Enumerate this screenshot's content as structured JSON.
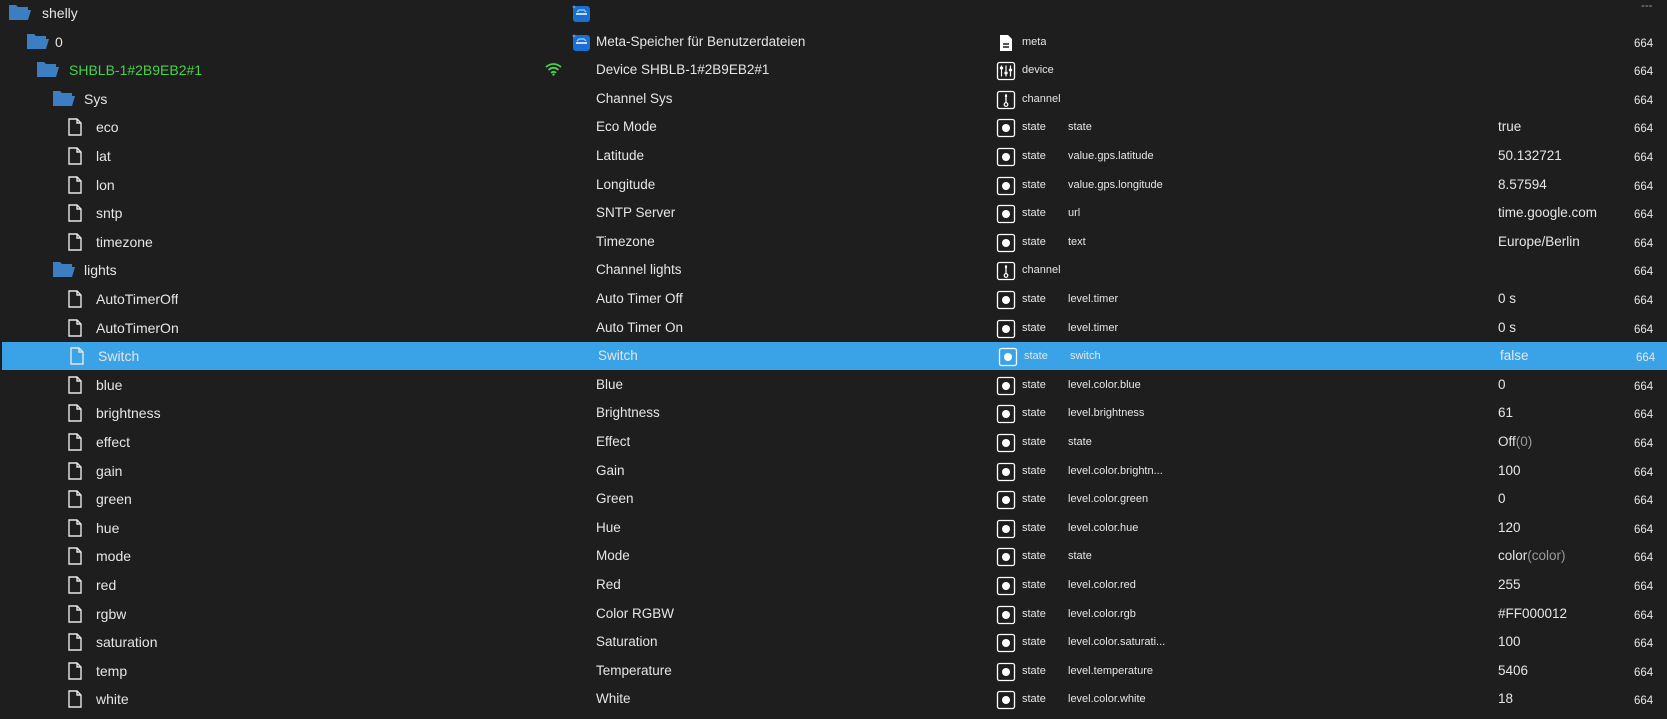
{
  "colors": {
    "background": "#1e1e1e",
    "selected_row": "#3aa3e8",
    "device_name": "#4ad14a",
    "wifi": "#4ad14a",
    "folder": "#3b7fc2",
    "text": "#e6e6e6",
    "value_hint": "#9a9a9a"
  },
  "rows": [
    {
      "kind": "folder",
      "level": 0,
      "name": "shelly",
      "desc": "",
      "adapter_icon": true,
      "type_icon": "",
      "type": "",
      "role": "",
      "value": "",
      "value_hint": "",
      "ts": "---"
    },
    {
      "kind": "folder",
      "level": 1,
      "name": "0",
      "desc": "Meta-Speicher für Benutzerdateien",
      "adapter_icon": true,
      "type_icon": "meta-icon",
      "type": "meta",
      "role": "",
      "value": "",
      "value_hint": "",
      "ts": "664"
    },
    {
      "kind": "folder",
      "level": 2,
      "name": "SHBLB-1#2B9EB2#1",
      "desc": "Device SHBLB-1#2B9EB2#1",
      "wifi": true,
      "name_color": "device",
      "type_icon": "device-icon",
      "type": "device",
      "role": "",
      "value": "",
      "value_hint": "",
      "ts": "664"
    },
    {
      "kind": "folder",
      "level": 3,
      "name": "Sys",
      "desc": "Channel Sys",
      "type_icon": "channel-icon",
      "type": "channel",
      "role": "",
      "value": "",
      "value_hint": "",
      "ts": "664"
    },
    {
      "kind": "file",
      "level": 4,
      "name": "eco",
      "desc": "Eco Mode",
      "type_icon": "state-icon",
      "type": "state",
      "role": "state",
      "value": "true",
      "value_hint": "",
      "ts": "664"
    },
    {
      "kind": "file",
      "level": 4,
      "name": "lat",
      "desc": "Latitude",
      "type_icon": "state-icon",
      "type": "state",
      "role": "value.gps.latitude",
      "value": "50.132721",
      "value_hint": "",
      "ts": "664"
    },
    {
      "kind": "file",
      "level": 4,
      "name": "lon",
      "desc": "Longitude",
      "type_icon": "state-icon",
      "type": "state",
      "role": "value.gps.longitude",
      "value": "8.57594",
      "value_hint": "",
      "ts": "664"
    },
    {
      "kind": "file",
      "level": 4,
      "name": "sntp",
      "desc": "SNTP Server",
      "type_icon": "state-icon",
      "type": "state",
      "role": "url",
      "value": "time.google.com",
      "value_hint": "",
      "ts": "664"
    },
    {
      "kind": "file",
      "level": 4,
      "name": "timezone",
      "desc": "Timezone",
      "type_icon": "state-icon",
      "type": "state",
      "role": "text",
      "value": "Europe/Berlin",
      "value_hint": "",
      "ts": "664"
    },
    {
      "kind": "folder",
      "level": 3,
      "name": "lights",
      "desc": "Channel lights",
      "type_icon": "channel-icon",
      "type": "channel",
      "role": "",
      "value": "",
      "value_hint": "",
      "ts": "664"
    },
    {
      "kind": "file",
      "level": 4,
      "name": "AutoTimerOff",
      "desc": "Auto Timer Off",
      "type_icon": "state-icon",
      "type": "state",
      "role": "level.timer",
      "value": "0 s",
      "value_hint": "",
      "ts": "664"
    },
    {
      "kind": "file",
      "level": 4,
      "name": "AutoTimerOn",
      "desc": "Auto Timer On",
      "type_icon": "state-icon",
      "type": "state",
      "role": "level.timer",
      "value": "0 s",
      "value_hint": "",
      "ts": "664"
    },
    {
      "kind": "file",
      "level": 4,
      "name": "Switch",
      "desc": "Switch",
      "selected": true,
      "type_icon": "state-icon",
      "type": "state",
      "role": "switch",
      "value": "false",
      "value_hint": "",
      "ts": "664"
    },
    {
      "kind": "file",
      "level": 4,
      "name": "blue",
      "desc": "Blue",
      "type_icon": "state-icon",
      "type": "state",
      "role": "level.color.blue",
      "value": "0",
      "value_hint": "",
      "ts": "664"
    },
    {
      "kind": "file",
      "level": 4,
      "name": "brightness",
      "desc": "Brightness",
      "type_icon": "state-icon",
      "type": "state",
      "role": "level.brightness",
      "value": "61",
      "value_hint": "",
      "ts": "664"
    },
    {
      "kind": "file",
      "level": 4,
      "name": "effect",
      "desc": "Effect",
      "type_icon": "state-icon",
      "type": "state",
      "role": "state",
      "value": "Off",
      "value_hint": "(0)",
      "ts": "664"
    },
    {
      "kind": "file",
      "level": 4,
      "name": "gain",
      "desc": "Gain",
      "type_icon": "state-icon",
      "type": "state",
      "role": "level.color.brightn...",
      "value": "100",
      "value_hint": "",
      "ts": "664"
    },
    {
      "kind": "file",
      "level": 4,
      "name": "green",
      "desc": "Green",
      "type_icon": "state-icon",
      "type": "state",
      "role": "level.color.green",
      "value": "0",
      "value_hint": "",
      "ts": "664"
    },
    {
      "kind": "file",
      "level": 4,
      "name": "hue",
      "desc": "Hue",
      "type_icon": "state-icon",
      "type": "state",
      "role": "level.color.hue",
      "value": "120",
      "value_hint": "",
      "ts": "664"
    },
    {
      "kind": "file",
      "level": 4,
      "name": "mode",
      "desc": "Mode",
      "type_icon": "state-icon",
      "type": "state",
      "role": "state",
      "value": "color",
      "value_hint": "(color)",
      "ts": "664"
    },
    {
      "kind": "file",
      "level": 4,
      "name": "red",
      "desc": "Red",
      "type_icon": "state-icon",
      "type": "state",
      "role": "level.color.red",
      "value": "255",
      "value_hint": "",
      "ts": "664"
    },
    {
      "kind": "file",
      "level": 4,
      "name": "rgbw",
      "desc": "Color RGBW",
      "type_icon": "state-icon",
      "type": "state",
      "role": "level.color.rgb",
      "value": "#FF000012",
      "value_hint": "",
      "ts": "664"
    },
    {
      "kind": "file",
      "level": 4,
      "name": "saturation",
      "desc": "Saturation",
      "type_icon": "state-icon",
      "type": "state",
      "role": "level.color.saturati...",
      "value": "100",
      "value_hint": "",
      "ts": "664"
    },
    {
      "kind": "file",
      "level": 4,
      "name": "temp",
      "desc": "Temperature",
      "type_icon": "state-icon",
      "type": "state",
      "role": "level.temperature",
      "value": "5406",
      "value_hint": "",
      "ts": "664"
    },
    {
      "kind": "file",
      "level": 4,
      "name": "white",
      "desc": "White",
      "type_icon": "state-icon",
      "type": "state",
      "role": "level.color.white",
      "value": "18",
      "value_hint": "",
      "ts": "664"
    }
  ]
}
